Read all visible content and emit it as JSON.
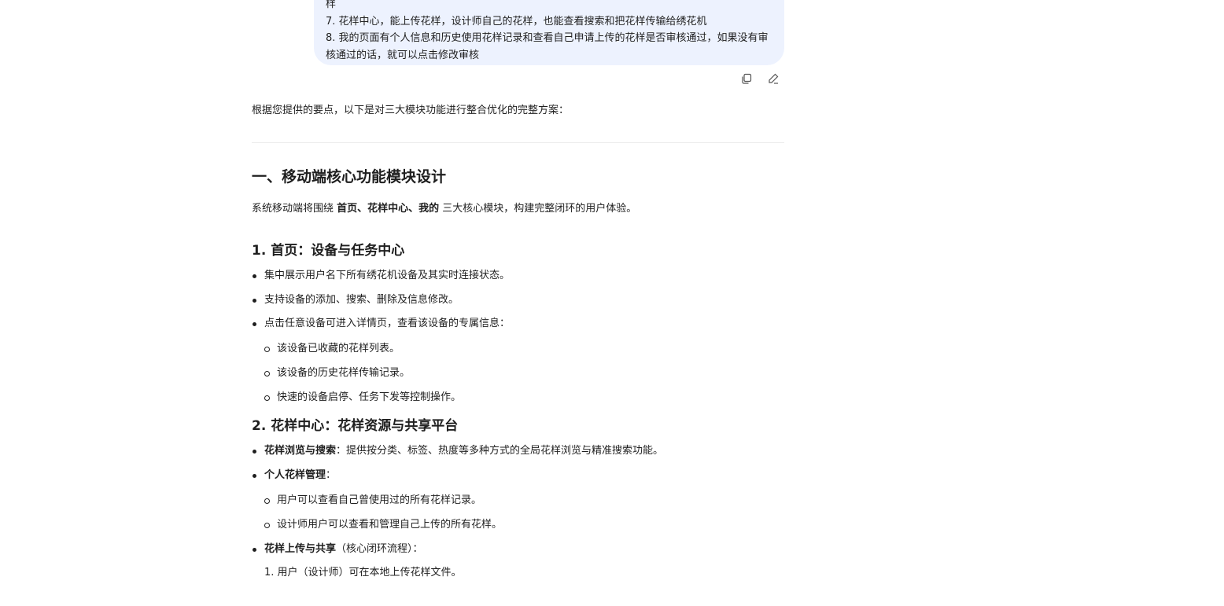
{
  "user_message": {
    "line_partial": "样",
    "line_7": "7. 花样中心，能上传花样，设计师自己的花样，也能查看搜索和把花样传输给绣花机",
    "line_8": "8. 我的页面有个人信息和历史使用花样记录和查看自己申请上传的花样是否审核通过，如果没有审核通过的话，就可以点击修改审核"
  },
  "actions": {
    "copy_icon": "copy-icon",
    "edit_icon": "edit-icon"
  },
  "answer": {
    "intro": "根据您提供的要点，以下是对三大模块功能进行整合优化的完整方案：",
    "section1": {
      "title": "一、移动端核心功能模块设计",
      "lead_prefix": "系统移动端将围绕 ",
      "lead_bold": "首页、花样中心、我的",
      "lead_suffix": " 三大核心模块，构建完整闭环的用户体验。"
    },
    "sub1": {
      "title": "1. 首页：设备与任务中心",
      "items": [
        "集中展示用户名下所有绣花机设备及其实时连接状态。",
        "支持设备的添加、搜索、删除及信息修改。",
        "点击任意设备可进入详情页，查看该设备的专属信息："
      ],
      "subitems": [
        "该设备已收藏的花样列表。",
        "该设备的历史花样传输记录。",
        "快速的设备启停、任务下发等控制操作。"
      ]
    },
    "sub2": {
      "title": "2. 花样中心：花样资源与共享平台",
      "browse_bold": "花样浏览与搜索",
      "browse_text": "：提供按分类、标签、热度等多种方式的全局花样浏览与精准搜索功能。",
      "manage_bold": "个人花样管理",
      "manage_text": "：",
      "manage_items": [
        "用户可以查看自己曾使用过的所有花样记录。",
        "设计师用户可以查看和管理自己上传的所有花样。"
      ],
      "upload_bold": "花样上传与共享",
      "upload_text": "（核心闭环流程）：",
      "upload_first": "1. 用户（设计师）可在本地上传花样文件。"
    }
  }
}
